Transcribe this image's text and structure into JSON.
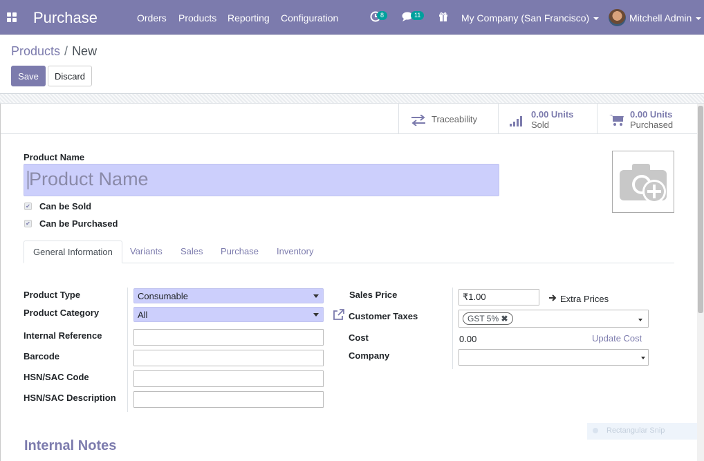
{
  "topbar": {
    "app_name": "Purchase",
    "menu": [
      "Orders",
      "Products",
      "Reporting",
      "Configuration"
    ],
    "activity_count": "8",
    "message_count": "11",
    "company": "My Company (San Francisco)",
    "user": "Mitchell Admin"
  },
  "control": {
    "breadcrumb_parent": "Products",
    "breadcrumb_sep": "/",
    "breadcrumb_current": "New",
    "save_label": "Save",
    "discard_label": "Discard"
  },
  "stat_buttons": {
    "traceability": "Traceability",
    "sold_value": "0.00 Units",
    "sold_label": "Sold",
    "purchased_value": "0.00 Units",
    "purchased_label": "Purchased"
  },
  "form": {
    "name_label": "Product Name",
    "name_placeholder": "Product Name",
    "can_be_sold": "Can be Sold",
    "can_be_purchased": "Can be Purchased",
    "tabs": [
      "General Information",
      "Variants",
      "Sales",
      "Purchase",
      "Inventory"
    ],
    "left_fields": {
      "product_type_label": "Product Type",
      "product_type_value": "Consumable",
      "category_label": "Product Category",
      "category_value": "All",
      "internal_ref_label": "Internal Reference",
      "barcode_label": "Barcode",
      "hsn_code_label": "HSN/SAC Code",
      "hsn_desc_label": "HSN/SAC Description"
    },
    "right_fields": {
      "sales_price_label": "Sales Price",
      "sales_price_value": "₹1.00",
      "extra_prices": "Extra Prices",
      "customer_taxes_label": "Customer Taxes",
      "tax_tag": "GST 5%",
      "cost_label": "Cost",
      "cost_value": "0.00",
      "update_cost": "Update Cost",
      "company_label": "Company"
    },
    "internal_notes": "Internal Notes"
  },
  "overlay": {
    "snip_label": "Rectangular Snip"
  },
  "colors": {
    "brand": "#7c7bad",
    "field_highlight": "#cccffc",
    "badge": "#00a09d"
  }
}
